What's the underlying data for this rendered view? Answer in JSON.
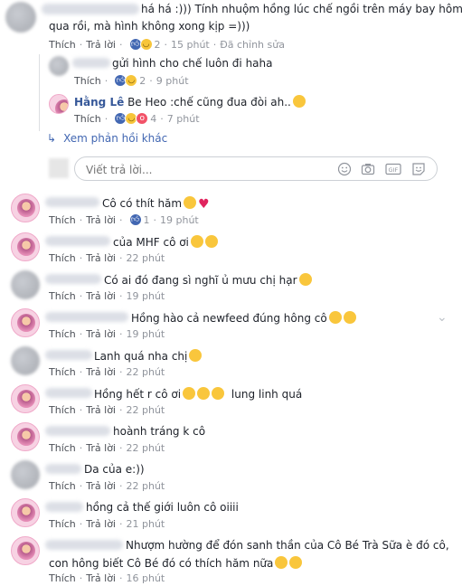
{
  "top_comment": {
    "text_l1": "há há :))) Tính nhuộm hồng lúc chế ngồi trên máy bay hôm",
    "text_l2": "qua rồi, mà hình không xong kịp =)))",
    "like": "Thích",
    "reply": "Trả lời",
    "reactions": "2",
    "time": "15 phút",
    "edited": "Đã chỉnh sửa"
  },
  "replies": [
    {
      "text": "gửi hình cho chế luôn đi haha",
      "like": "Thích",
      "reply": "Trả lời",
      "reactions": "2",
      "time": "9 phút"
    },
    {
      "name": "Hằng Lê",
      "text": "Be Heo :chế cũng đua đòi ah..",
      "like": "Thích",
      "reply": "Trả lời",
      "reactions": "4",
      "time": "7 phút"
    }
  ],
  "see_more": "Xem phản hồi khác",
  "reply_input": {
    "placeholder": "Viết trả lời..."
  },
  "input_icons": [
    "emoji-icon",
    "camera-icon",
    "gif-icon",
    "sticker-icon"
  ],
  "comments": [
    {
      "text": "Cô có thít hăm",
      "like": "Thích",
      "reply": "Trả lời",
      "reactions": "1",
      "time": "19 phút"
    },
    {
      "text": "của MHF cô ơi",
      "like": "Thích",
      "reply": "Trả lời",
      "time": "22 phút"
    },
    {
      "text": "Có ai đó đang sì nghĩ ủ mưu chị hạr",
      "like": "Thích",
      "reply": "Trả lời",
      "time": "19 phút"
    },
    {
      "text": "Hồng hào cả newfeed đúng hông cô",
      "like": "Thích",
      "reply": "Trả lời",
      "time": "19 phút"
    },
    {
      "text": "Lanh quá nha chị",
      "like": "Thích",
      "reply": "Trả lời",
      "time": "22 phút"
    },
    {
      "text": "Hồng hết r cô ơi",
      "text2": "lung linh quá",
      "like": "Thích",
      "reply": "Trả lời",
      "time": "22 phút"
    },
    {
      "text": "hoành tráng k cô",
      "like": "Thích",
      "reply": "Trả lời",
      "time": "22 phút"
    },
    {
      "text": "Da của e:))",
      "like": "Thích",
      "reply": "Trả lời",
      "time": "22 phút"
    },
    {
      "text": "hồng cả thế giới luôn cô oiiii",
      "like": "Thích",
      "reply": "Trả lời",
      "time": "21 phút"
    },
    {
      "text_l1": "Nhượm hường để đón sanh thần của Cô Bé Trà Sữa è đó cô,",
      "text_l2": "con hông biết Cô Bé đó có thích hăm nữa",
      "like": "Thích",
      "reply": "Trả lời",
      "time": "16 phút"
    }
  ],
  "colors": {
    "link": "#365899",
    "meta": "#90949c",
    "like_blue": "#4267b2"
  }
}
